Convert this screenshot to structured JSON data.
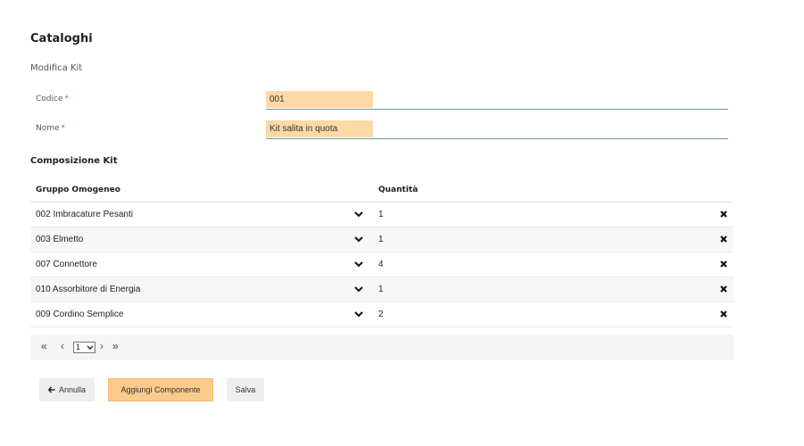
{
  "header": {
    "title": "Cataloghi",
    "subtitle": "Modifica Kit"
  },
  "form": {
    "codice": {
      "label": "Codice",
      "required_mark": "*",
      "value": "001"
    },
    "nome": {
      "label": "Nome",
      "required_mark": "*",
      "value": "Kit salita in quota"
    }
  },
  "composition": {
    "title": "Composizione Kit",
    "columns": {
      "group": "Gruppo Omogeneo",
      "qty": "Quantità"
    },
    "rows": [
      {
        "group": "002 Imbracature Pesanti",
        "qty": "1"
      },
      {
        "group": "003 Elmetto",
        "qty": "1"
      },
      {
        "group": "007 Connettore",
        "qty": "4"
      },
      {
        "group": "010 Assorbitore di Energia",
        "qty": "1"
      },
      {
        "group": "009 Cordino Semplice",
        "qty": "2"
      }
    ]
  },
  "pager": {
    "first": "«",
    "prev": "‹",
    "page": "1",
    "next": "›",
    "last": "»"
  },
  "actions": {
    "cancel_label": "Annulla",
    "add_label": "Aggiungi Componente",
    "save_label": "Salva"
  },
  "icons": {
    "dropdown": "chevron-down-icon",
    "delete": "close-icon",
    "back": "arrow-left-icon"
  },
  "colors": {
    "input_bg": "#fdd9a8",
    "accent_button": "#fbcb8c",
    "required": "#e74c3c",
    "field_underline": "#6e98a3"
  }
}
